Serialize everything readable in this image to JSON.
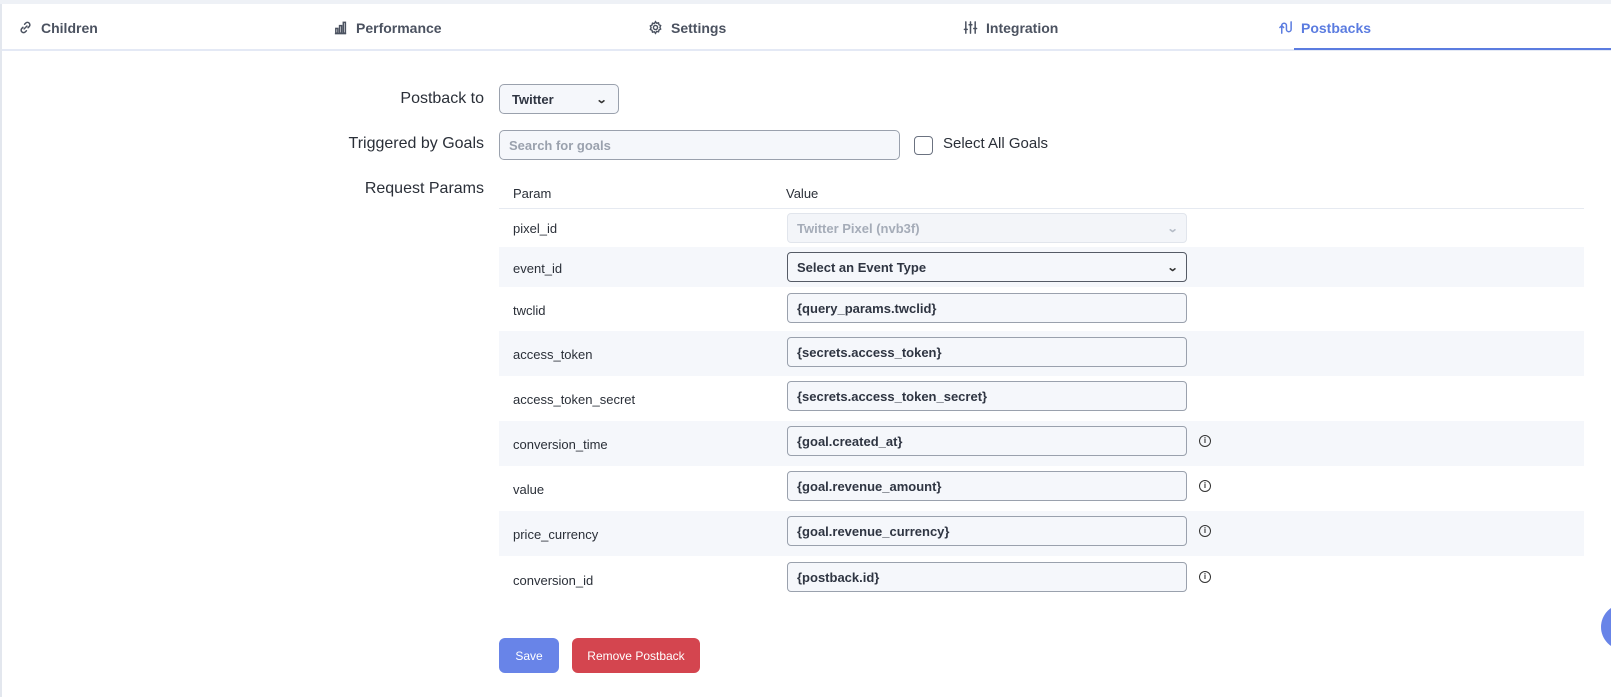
{
  "tabs": [
    {
      "label": "Children",
      "icon": "link-icon"
    },
    {
      "label": "Performance",
      "icon": "bar-chart-icon"
    },
    {
      "label": "Settings",
      "icon": "gear-icon"
    },
    {
      "label": "Integration",
      "icon": "sliders-icon"
    },
    {
      "label": "Postbacks",
      "icon": "postback-icon",
      "active": true
    }
  ],
  "form": {
    "postback_to_label": "Postback to",
    "postback_to_value": "Twitter",
    "goals_label": "Triggered by Goals",
    "goals_placeholder": "Search for goals",
    "select_all_label": "Select All Goals",
    "request_params_label": "Request Params"
  },
  "table": {
    "headers": {
      "param": "Param",
      "value": "Value"
    },
    "rows": [
      {
        "param": "pixel_id",
        "value": "Twitter Pixel (nvb3f)",
        "type": "select-disabled"
      },
      {
        "param": "event_id",
        "value": "Select an Event Type",
        "type": "select"
      },
      {
        "param": "twclid",
        "value": "{query_params.twclid}",
        "type": "input"
      },
      {
        "param": "access_token",
        "value": "{secrets.access_token}",
        "type": "input"
      },
      {
        "param": "access_token_secret",
        "value": "{secrets.access_token_secret}",
        "type": "input"
      },
      {
        "param": "conversion_time",
        "value": "{goal.created_at}",
        "type": "input",
        "info": true
      },
      {
        "param": "value",
        "value": "{goal.revenue_amount}",
        "type": "input",
        "info": true
      },
      {
        "param": "price_currency",
        "value": "{goal.revenue_currency}",
        "type": "input",
        "info": true
      },
      {
        "param": "conversion_id",
        "value": "{postback.id}",
        "type": "input",
        "info": true
      }
    ]
  },
  "buttons": {
    "save": "Save",
    "remove": "Remove Postback"
  },
  "colors": {
    "accent": "#5b7ce0",
    "primary_button": "#6884e8",
    "danger_button": "#d4454f",
    "stripe": "#f5f7fb"
  }
}
